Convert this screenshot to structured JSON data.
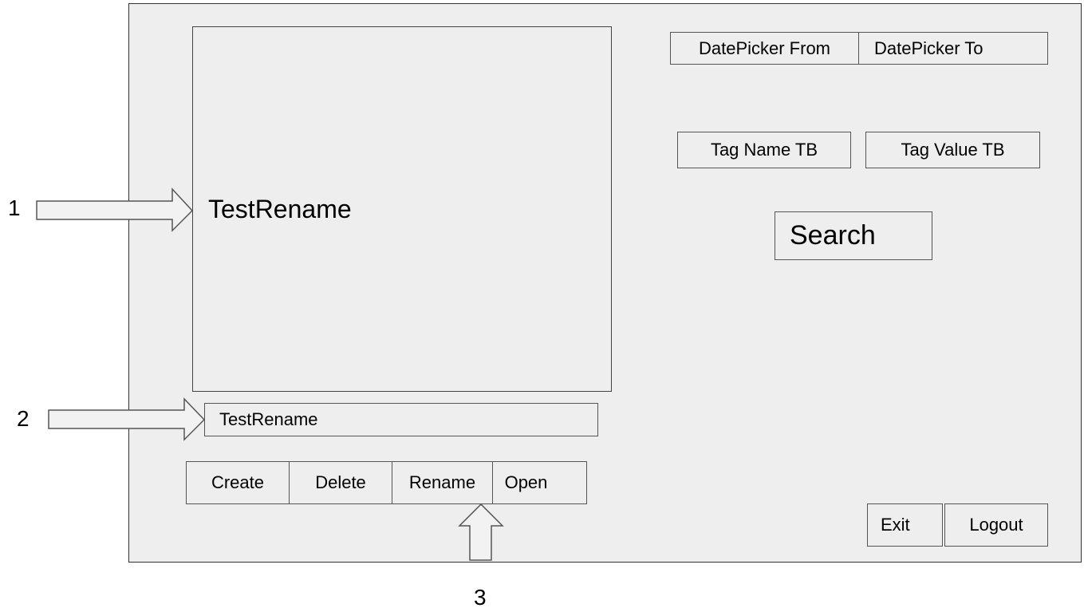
{
  "file_list": {
    "selected_item": "TestRename"
  },
  "rename_field": {
    "value": "TestRename"
  },
  "file_actions": {
    "create_label": "Create",
    "delete_label": "Delete",
    "rename_label": "Rename",
    "open_label": "Open"
  },
  "date_filters": {
    "from_label": "DatePicker From",
    "to_label": "DatePicker To"
  },
  "tag_filters": {
    "name_label": "Tag Name TB",
    "value_label": "Tag Value TB"
  },
  "search": {
    "label": "Search"
  },
  "session": {
    "exit_label": "Exit",
    "logout_label": "Logout"
  },
  "annotations": {
    "label_1": "1",
    "label_2": "2",
    "label_3": "3"
  }
}
